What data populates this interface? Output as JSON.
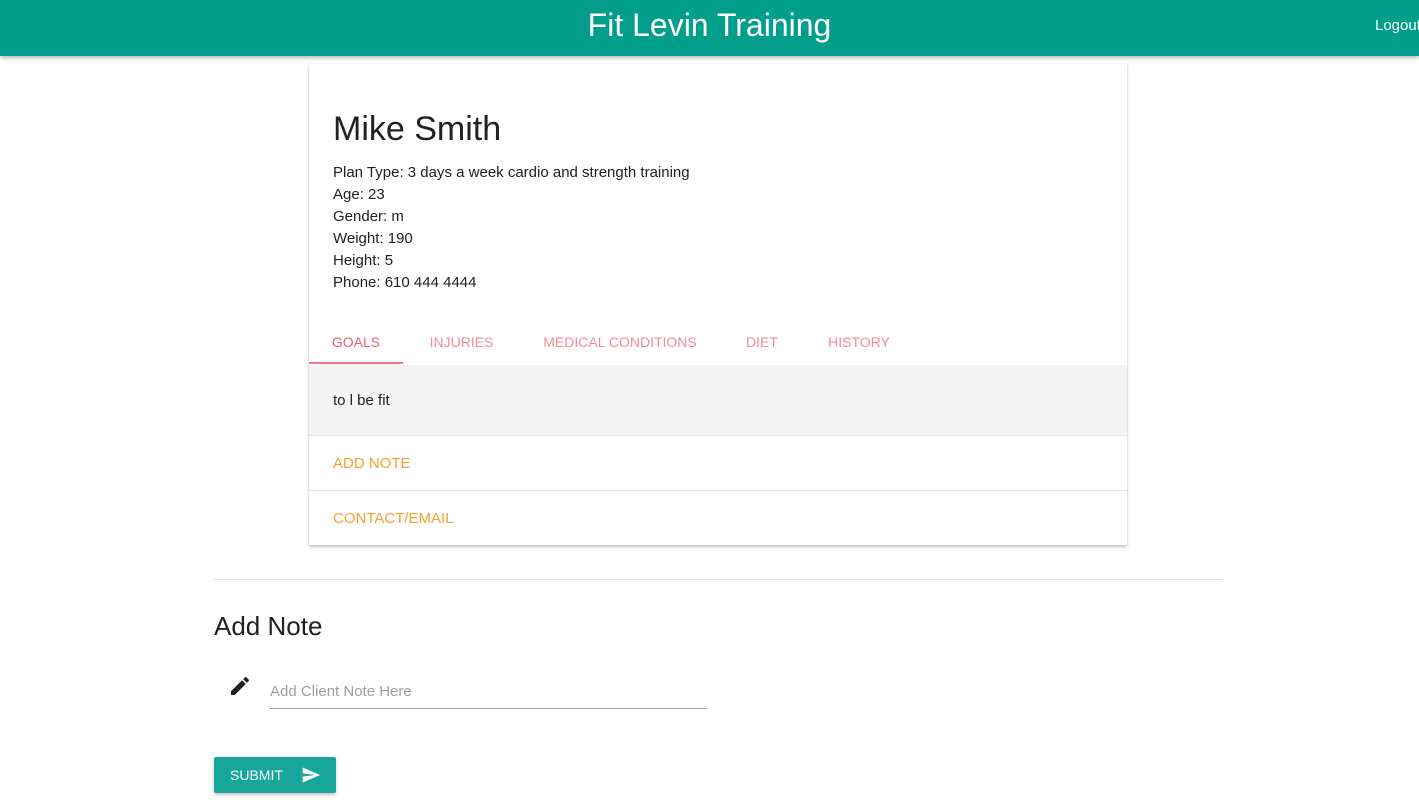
{
  "header": {
    "title": "Fit Levin Training",
    "logout_label": "Logout"
  },
  "client": {
    "name": "Mike Smith",
    "info": [
      "Plan Type: 3 days a week cardio and strength training",
      "Age: 23",
      "Gender: m",
      "Weight: 190",
      "Height: 5",
      "Phone: 610 444 4444"
    ]
  },
  "tabs": [
    {
      "label": "GOALS",
      "active": true
    },
    {
      "label": "INJURIES",
      "active": false
    },
    {
      "label": "MEDICAL CONDITIONS",
      "active": false
    },
    {
      "label": "DIET",
      "active": false
    },
    {
      "label": "HISTORY",
      "active": false
    }
  ],
  "tab_content": "to l be fit",
  "actions": {
    "add_note": "ADD NOTE",
    "contact_email": "CONTACT/EMAIL"
  },
  "note_form": {
    "title": "Add Note",
    "icon": "pencil-icon",
    "placeholder": "Add Client Note Here",
    "value": "",
    "submit_label": "SUBMIT",
    "submit_icon": "send-icon"
  },
  "colors": {
    "primary": "#009e8b",
    "tab_text": "#f48a95",
    "tab_active": "#ee5f70",
    "action_text": "#f5a02e",
    "submit_bg": "#16a79a"
  }
}
